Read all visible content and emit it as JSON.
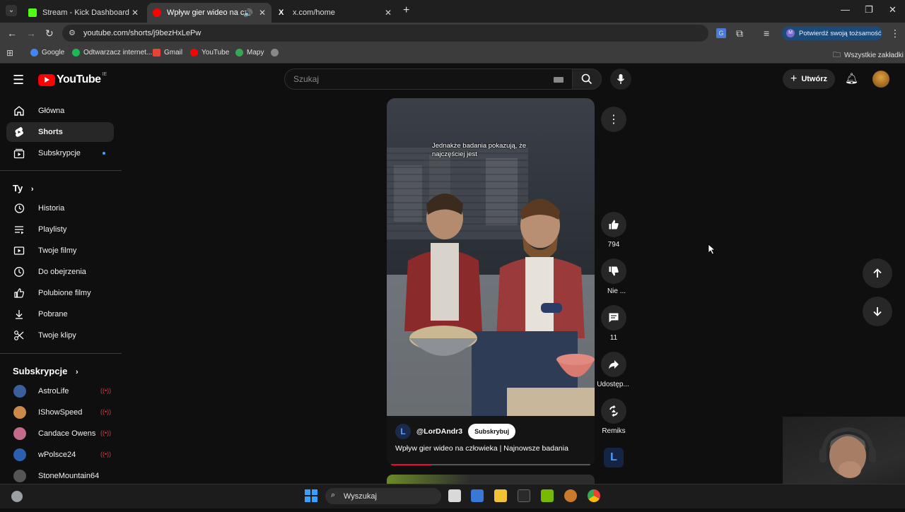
{
  "tabs": [
    {
      "title": "Stream - Kick Dashboard",
      "icon": "kick-icon"
    },
    {
      "title": "Wpływ gier wideo na człow",
      "icon": "youtube-icon",
      "active": true
    },
    {
      "title": "x.com/home",
      "icon": "x-icon"
    }
  ],
  "address": {
    "url": "youtube.com/shorts/j9bezHxLePw"
  },
  "profile_button": {
    "letter": "M",
    "label": "Potwierdź swoją tożsamość"
  },
  "bookmarks": [
    {
      "label": "Google",
      "color": "#4285f4"
    },
    {
      "label": "Odtwarzacz internet...",
      "color": "#1db954"
    },
    {
      "label": "Gmail",
      "color": "#ea4335"
    },
    {
      "label": "YouTube",
      "color": "#ff0000"
    },
    {
      "label": "Mapy",
      "color": "#34a853"
    },
    {
      "label": "",
      "color": "#888888"
    }
  ],
  "all_bookmarks": "Wszystkie zakładki",
  "yt": {
    "logo_text": "YouTube",
    "region": "IE",
    "search_placeholder": "Szukaj",
    "create_label": "Utwórz"
  },
  "sidebar": {
    "main": [
      {
        "label": "Główna",
        "icon": "home-icon"
      },
      {
        "label": "Shorts",
        "icon": "shorts-icon",
        "active": true
      },
      {
        "label": "Subskrypcje",
        "icon": "subscriptions-icon",
        "dot": true
      }
    ],
    "you_heading": "Ty",
    "you": [
      {
        "label": "Historia",
        "icon": "history-icon"
      },
      {
        "label": "Playlisty",
        "icon": "playlist-icon"
      },
      {
        "label": "Twoje filmy",
        "icon": "your-videos-icon"
      },
      {
        "label": "Do obejrzenia",
        "icon": "watch-later-icon"
      },
      {
        "label": "Polubione filmy",
        "icon": "liked-icon"
      },
      {
        "label": "Pobrane",
        "icon": "download-icon"
      },
      {
        "label": "Twoje klipy",
        "icon": "clips-icon"
      }
    ],
    "subs_heading": "Subskrypcje",
    "subs": [
      {
        "label": "AstroLife",
        "color": "#3a5f9a"
      },
      {
        "label": "IShowSpeed",
        "color": "#c98a4a"
      },
      {
        "label": "Candace Owens",
        "color": "#c46a8a"
      },
      {
        "label": "wPolsce24",
        "color": "#2d5fb0"
      },
      {
        "label": "StoneMountain64",
        "color": "#555555"
      }
    ]
  },
  "short": {
    "caption": "Jednakże badania pokazują, że najczęściej jest",
    "channel": "@LorDAndr3",
    "subscribe": "Subskrybuj",
    "title": "Wpływ gier wideo na człowieka | Najnowsze badania",
    "progress": 0.2
  },
  "actions": {
    "likes": "794",
    "dislike": "Nie ...",
    "comments": "11",
    "share": "Udostęp...",
    "remix": "Remiks"
  },
  "taskbar": {
    "search": "Wyszukaj"
  }
}
